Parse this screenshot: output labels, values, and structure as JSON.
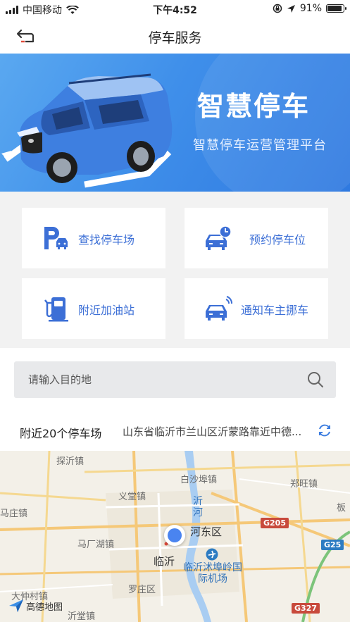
{
  "status_bar": {
    "carrier": "中国移动",
    "time": "下午4:52",
    "battery": "91%",
    "battery_level": 0.91
  },
  "nav": {
    "title": "停车服务",
    "back_icon": "back-arrow-icon"
  },
  "banner": {
    "title": "智慧停车",
    "subtitle": "智慧停车运营管理平台"
  },
  "services": [
    {
      "label": "查找停车场",
      "icon": "parking-icon"
    },
    {
      "label": "预约停车位",
      "icon": "car-clock-icon"
    },
    {
      "label": "附近加油站",
      "icon": "gas-station-icon"
    },
    {
      "label": "通知车主挪车",
      "icon": "car-signal-icon"
    }
  ],
  "search": {
    "placeholder": "请输入目的地",
    "icon": "search-icon"
  },
  "nearby": {
    "title": "附近20个停车场",
    "address": "山东省临沂市兰山区沂蒙路靠近中德...",
    "refresh_icon": "refresh-icon"
  },
  "map": {
    "labels": {
      "tancheng": "探沂镇",
      "baishabu": "白沙埠镇",
      "zhengwang": "郑旺镇",
      "yitang": "义堂镇",
      "mazhuang": "马庄镇",
      "yihe": "沂河",
      "hedong": "河东区",
      "magonghu": "马厂湖镇",
      "linyi": "临沂",
      "airport": "临沂沭埠岭国际机场",
      "luozhuang": "罗庄区",
      "dazhongcun": "大仲村镇",
      "yitangzhen2": "沂堂镇",
      "ban": "板"
    },
    "shields": {
      "g205": "G205",
      "g25": "G25",
      "g327": "G327"
    },
    "logo": "高德地图"
  }
}
